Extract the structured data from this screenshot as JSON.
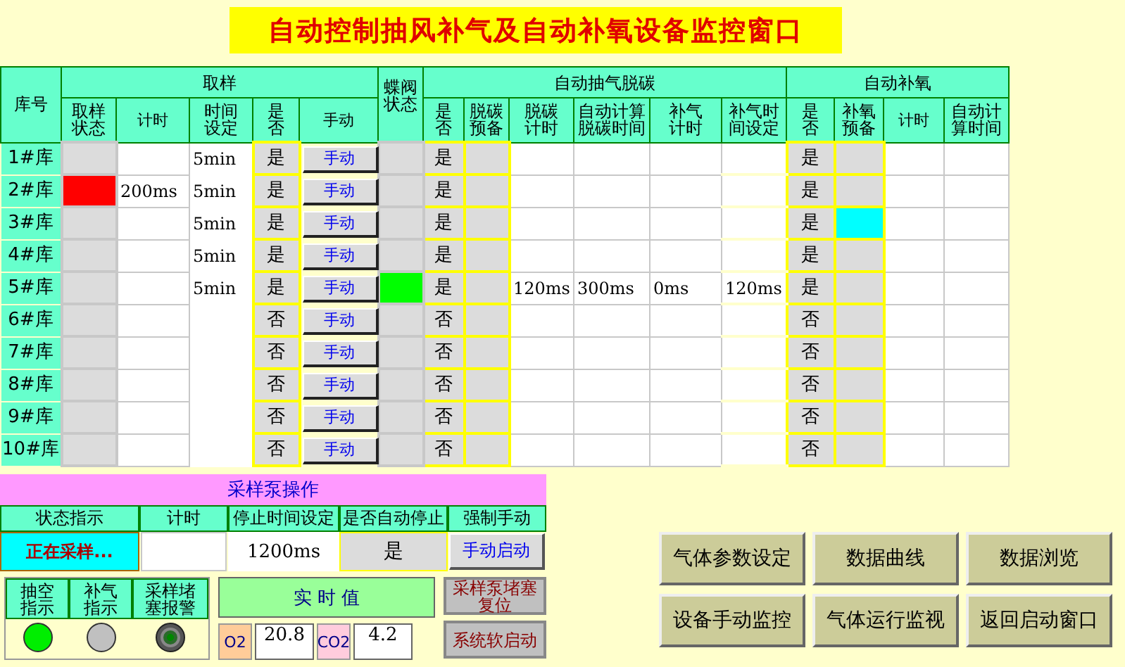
{
  "title": "自动控制抽风补气及自动补氧设备监控窗口",
  "headers": {
    "row_label": "库号",
    "sampling": {
      "title": "取样",
      "columns": [
        {
          "label": "取样状态",
          "wrap": true
        },
        {
          "label": "计时",
          "wrap": false
        },
        {
          "label": "时间设定",
          "wrap": true
        },
        {
          "label": "是否",
          "wrap": true
        },
        {
          "label": "手动",
          "wrap": false
        }
      ]
    },
    "valve": "蝶阀状态",
    "decarb": {
      "title": "自动抽气脱碳",
      "columns": [
        {
          "label": "是否",
          "wrap": true
        },
        {
          "label": "脱碳预备",
          "wrap": true
        },
        {
          "label": "脱碳计时",
          "wrap": true
        },
        {
          "label": "自动计算脱碳时间",
          "wrap": true
        },
        {
          "label": "补气计时",
          "wrap": true
        },
        {
          "label": "补气时间设定",
          "wrap": true
        }
      ]
    },
    "oxygen": {
      "title": "自动补氧",
      "columns": [
        {
          "label": "是否",
          "wrap": true
        },
        {
          "label": "补氧预备",
          "wrap": true
        },
        {
          "label": "计时",
          "wrap": false
        },
        {
          "label": "自动计算时间",
          "wrap": true
        }
      ]
    }
  },
  "rows": [
    {
      "label": "1#库",
      "sampling": false,
      "time_setting": "5min",
      "enabled": "是",
      "manual": "手动",
      "valve_open": false,
      "decarb_enabled": "是",
      "decarb_ready": false,
      "oxygen_enabled": "是",
      "oxygen_ready": false
    },
    {
      "label": "2#库",
      "sampling": true,
      "timer": "200ms",
      "time_setting": "5min",
      "enabled": "是",
      "manual": "手动",
      "valve_open": false,
      "decarb_enabled": "是",
      "decarb_ready": false,
      "oxygen_enabled": "是",
      "oxygen_ready": false
    },
    {
      "label": "3#库",
      "sampling": false,
      "time_setting": "5min",
      "enabled": "是",
      "manual": "手动",
      "valve_open": false,
      "decarb_enabled": "是",
      "decarb_ready": false,
      "oxygen_enabled": "是",
      "oxygen_ready": true
    },
    {
      "label": "4#库",
      "sampling": false,
      "time_setting": "5min",
      "enabled": "是",
      "manual": "手动",
      "valve_open": false,
      "decarb_enabled": "是",
      "decarb_ready": false,
      "oxygen_enabled": "是",
      "oxygen_ready": false
    },
    {
      "label": "5#库",
      "sampling": false,
      "time_setting": "5min",
      "enabled": "是",
      "manual": "手动",
      "valve_open": true,
      "decarb_enabled": "是",
      "decarb_ready": false,
      "decarb_timer": "120ms",
      "auto_decarb_time": "300ms",
      "refill_timer": "0ms",
      "refill_setting": "120ms",
      "oxygen_enabled": "是",
      "oxygen_ready": false
    },
    {
      "label": "6#库",
      "sampling": false,
      "enabled": "否",
      "manual": "手动",
      "valve_open": false,
      "decarb_enabled": "否",
      "decarb_ready": false,
      "oxygen_enabled": "否",
      "oxygen_ready": false
    },
    {
      "label": "7#库",
      "sampling": false,
      "enabled": "否",
      "manual": "手动",
      "valve_open": false,
      "decarb_enabled": "否",
      "decarb_ready": false,
      "oxygen_enabled": "否",
      "oxygen_ready": false
    },
    {
      "label": "8#库",
      "sampling": false,
      "enabled": "否",
      "manual": "手动",
      "valve_open": false,
      "decarb_enabled": "否",
      "decarb_ready": false,
      "oxygen_enabled": "否",
      "oxygen_ready": false
    },
    {
      "label": "9#库",
      "sampling": false,
      "enabled": "否",
      "manual": "手动",
      "valve_open": false,
      "decarb_enabled": "否",
      "decarb_ready": false,
      "oxygen_enabled": "否",
      "oxygen_ready": false
    },
    {
      "label": "10#库",
      "sampling": false,
      "enabled": "否",
      "manual": "手动",
      "valve_open": false,
      "decarb_enabled": "否",
      "decarb_ready": false,
      "oxygen_enabled": "否",
      "oxygen_ready": false
    }
  ],
  "pump": {
    "title": "采样泵操作",
    "columns": [
      "状态指示",
      "计时",
      "停止时间设定",
      "是否自动停止",
      "强制手动"
    ],
    "status": "正在采样...",
    "running": true,
    "stop_time": "1200ms",
    "auto_stop": "是",
    "manual_button": "手动启动"
  },
  "indicators": [
    {
      "label": "抽空指示",
      "kind": "lamp",
      "on": true
    },
    {
      "label": "补气指示",
      "kind": "lamp",
      "on": false
    },
    {
      "label": "采样堵塞报警",
      "kind": "alarm",
      "on": false
    }
  ],
  "realtime": {
    "title": "实 时 值",
    "values": [
      {
        "label": "O2",
        "value": "20.8",
        "color": "#ffcc99"
      },
      {
        "label": "CO2",
        "value": "4.2",
        "color": "#ffccdd"
      }
    ]
  },
  "pump_buttons": [
    "采样泵堵塞复位",
    "系统软启动"
  ],
  "nav_buttons": [
    "气体参数设定",
    "数据曲线",
    "数据浏览",
    "设备手动监控",
    "气体运行监视",
    "返回启动窗口"
  ]
}
